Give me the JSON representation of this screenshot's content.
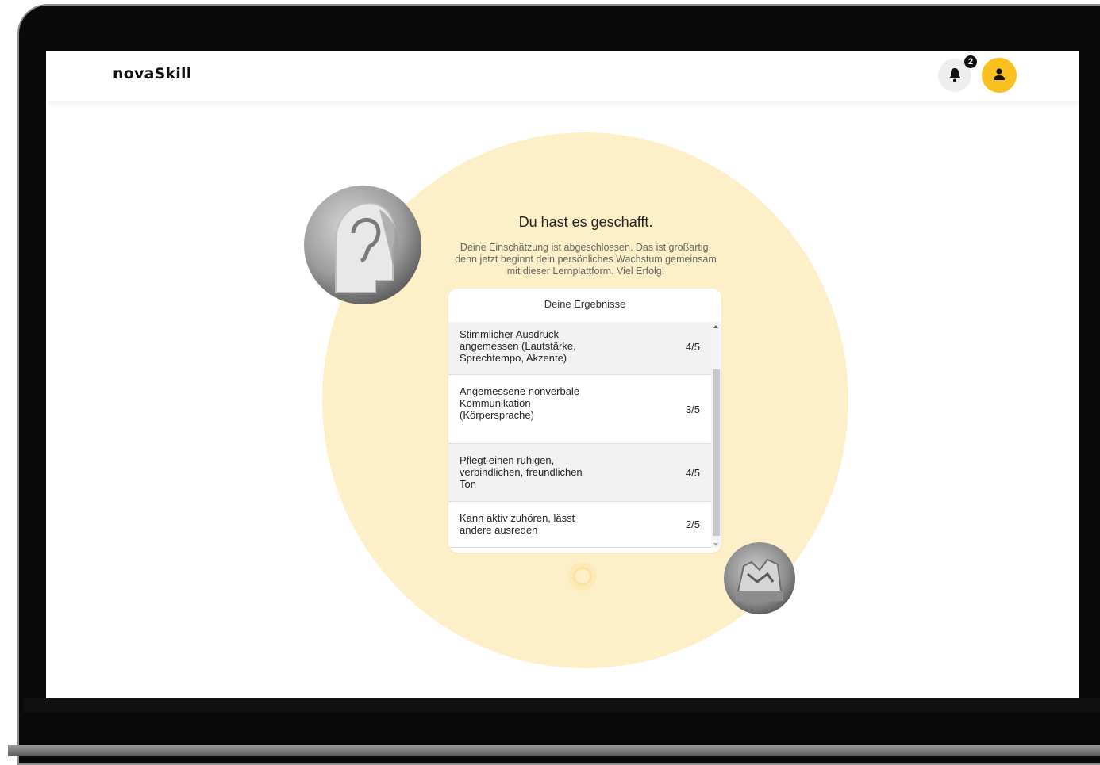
{
  "app": {
    "logo": "novaSkill",
    "notifications_count": "2",
    "colors": {
      "accent": "#f9c020",
      "background_circle": "#fdefc7",
      "row_shaded": "#f2f2f2"
    },
    "icons": [
      "bell-icon",
      "user-icon"
    ]
  },
  "main": {
    "title": "Du hast es geschafft.",
    "subtitle": "Deine Einschätzung ist abgeschlossen. Das ist großartig, denn jetzt beginnt dein persönliches Wachstum gemeinsam mit dieser Lernplattform. Viel Erfolg!"
  },
  "results": {
    "header": "Deine Ergebnisse",
    "rows": [
      {
        "label": "Stimmlicher Ausdruck angemessen (Lautstärke, Sprechtempo, Akzente)",
        "score": "4/5"
      },
      {
        "label": "Angemessene nonverbale Kommunikation (Körpersprache)",
        "score": "3/5"
      },
      {
        "label": "Pflegt einen ruhigen, verbindlichen, freundlichen Ton",
        "score": "4/5"
      },
      {
        "label": "Kann aktiv zuhören, lässt andere ausreden",
        "score": "2/5"
      }
    ]
  }
}
